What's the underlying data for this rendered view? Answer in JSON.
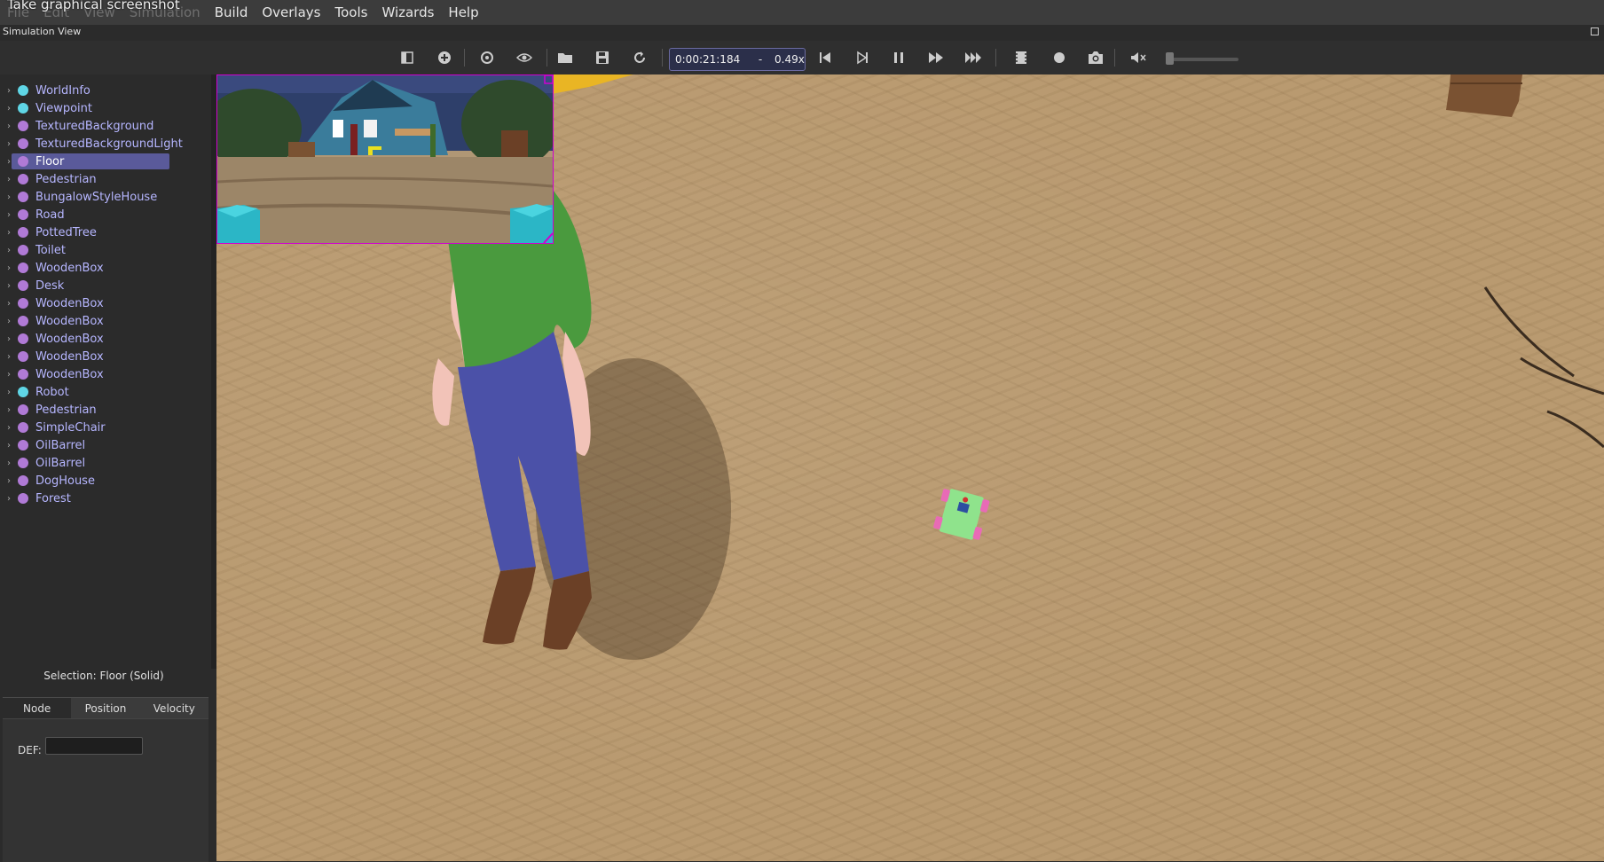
{
  "tooltip": "Take graphical screenshot",
  "menubar": {
    "items": [
      {
        "label": "File",
        "dim": true
      },
      {
        "label": "Edit",
        "dim": true
      },
      {
        "label": "View",
        "dim": true
      },
      {
        "label": "Simulation",
        "dim": true
      },
      {
        "label": "Build",
        "dim": false
      },
      {
        "label": "Overlays",
        "dim": false
      },
      {
        "label": "Tools",
        "dim": false
      },
      {
        "label": "Wizards",
        "dim": false
      },
      {
        "label": "Help",
        "dim": false
      }
    ]
  },
  "simulation_view": {
    "title": "Simulation View"
  },
  "toolbar": {
    "time": "0:00:21:184",
    "separator": "-",
    "speed": "0.49x",
    "volume_level": 0.0
  },
  "scene_tree": {
    "items": [
      {
        "label": "WorldInfo",
        "color": "#5fd6e6"
      },
      {
        "label": "Viewpoint",
        "color": "#5fd6e6"
      },
      {
        "label": "TexturedBackground",
        "color": "#b07ad6"
      },
      {
        "label": "TexturedBackgroundLight",
        "color": "#b07ad6"
      },
      {
        "label": "Floor",
        "color": "#b07ad6",
        "selected": true
      },
      {
        "label": "Pedestrian",
        "color": "#b07ad6"
      },
      {
        "label": "BungalowStyleHouse",
        "color": "#b07ad6"
      },
      {
        "label": "Road",
        "color": "#b07ad6"
      },
      {
        "label": "PottedTree",
        "color": "#b07ad6"
      },
      {
        "label": "Toilet",
        "color": "#b07ad6"
      },
      {
        "label": "WoodenBox",
        "color": "#b07ad6"
      },
      {
        "label": "Desk",
        "color": "#b07ad6"
      },
      {
        "label": "WoodenBox",
        "color": "#b07ad6"
      },
      {
        "label": "WoodenBox",
        "color": "#b07ad6"
      },
      {
        "label": "WoodenBox",
        "color": "#b07ad6"
      },
      {
        "label": "WoodenBox",
        "color": "#b07ad6"
      },
      {
        "label": "WoodenBox",
        "color": "#b07ad6"
      },
      {
        "label": "Robot",
        "color": "#5fd6e6"
      },
      {
        "label": "Pedestrian",
        "color": "#b07ad6"
      },
      {
        "label": "SimpleChair",
        "color": "#b07ad6"
      },
      {
        "label": "OilBarrel",
        "color": "#b07ad6"
      },
      {
        "label": "OilBarrel",
        "color": "#b07ad6"
      },
      {
        "label": "DogHouse",
        "color": "#b07ad6"
      },
      {
        "label": "Forest",
        "color": "#b07ad6"
      }
    ]
  },
  "properties": {
    "selection": "Selection: Floor (Solid)",
    "tabs": [
      {
        "label": "Node",
        "active": true
      },
      {
        "label": "Position",
        "active": false
      },
      {
        "label": "Velocity",
        "active": false
      }
    ],
    "def_label": "DEF:",
    "def_value": ""
  }
}
